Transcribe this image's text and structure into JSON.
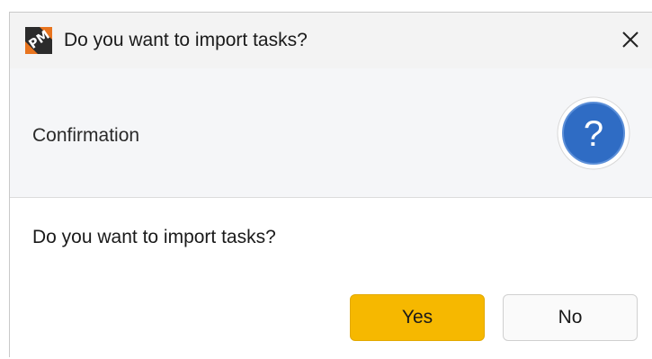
{
  "window": {
    "title": "Do you want to import tasks?",
    "app_icon": "project-manager-app-icon",
    "close_icon": "close-icon"
  },
  "header": {
    "label": "Confirmation",
    "icon": "question-icon",
    "icon_glyph": "?",
    "icon_color": "#2f6cc4"
  },
  "body": {
    "message": "Do you want to import tasks?"
  },
  "buttons": {
    "yes_label": "Yes",
    "no_label": "No",
    "yes_color": "#f6b800"
  }
}
